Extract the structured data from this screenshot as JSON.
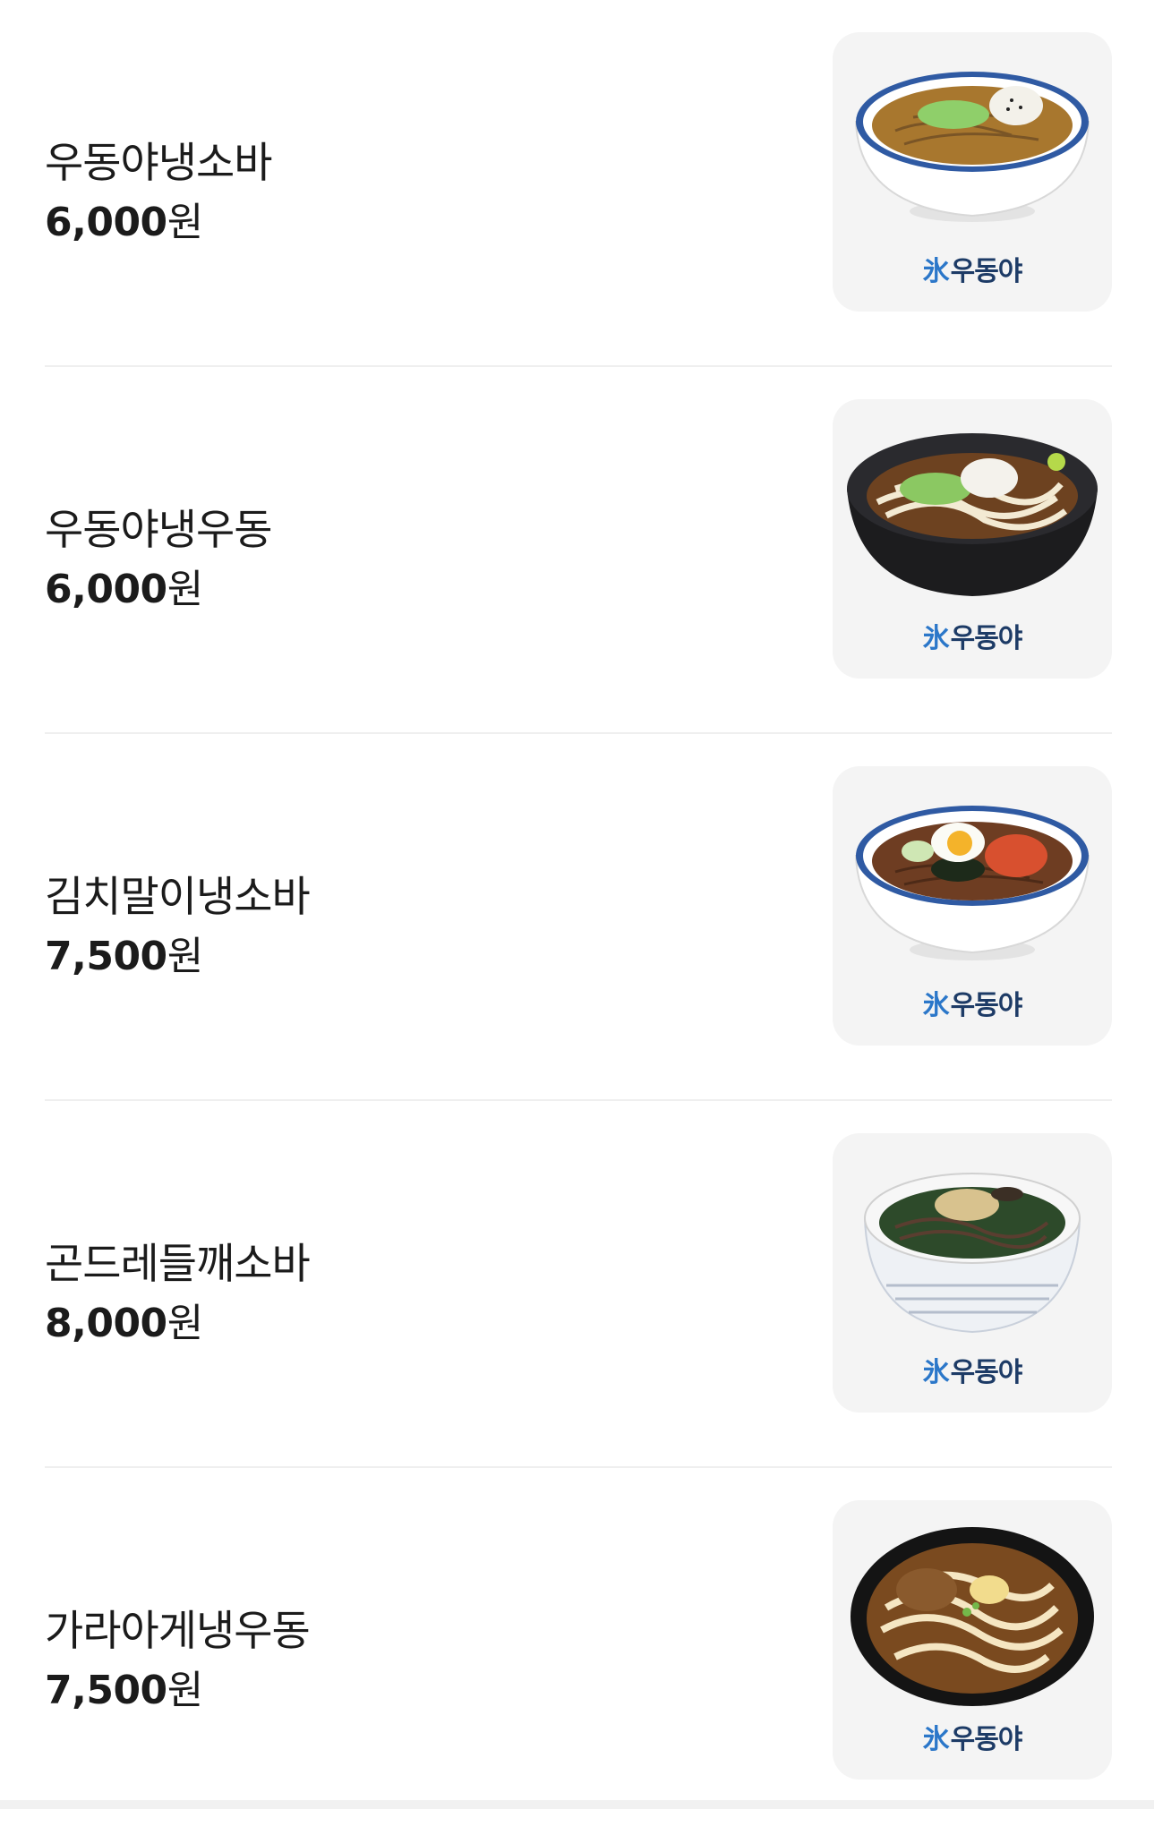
{
  "brand_mark": {
    "ice": "氷",
    "name": "우동야"
  },
  "menu": [
    {
      "name": "우동야냉소바",
      "price": "6,000",
      "unit": "원",
      "bowl": "blue-rim",
      "noodle": "soba-broth"
    },
    {
      "name": "우동야냉우동",
      "price": "6,000",
      "unit": "원",
      "bowl": "black",
      "noodle": "udon-radish"
    },
    {
      "name": "김치말이냉소바",
      "price": "7,500",
      "unit": "원",
      "bowl": "blue-rim",
      "noodle": "soba-kimchi-egg"
    },
    {
      "name": "곤드레들깨소바",
      "price": "8,000",
      "unit": "원",
      "bowl": "white-pattern",
      "noodle": "soba-greens"
    },
    {
      "name": "가라아게냉우동",
      "price": "7,500",
      "unit": "원",
      "bowl": "black",
      "noodle": "udon-karaage"
    }
  ],
  "colors": {
    "text": "#1b1b1b",
    "thumb_bg": "#f4f4f4",
    "divider": "#efefef",
    "brand_blue": "#2b77c9",
    "brand_navy": "#1d3b66"
  }
}
